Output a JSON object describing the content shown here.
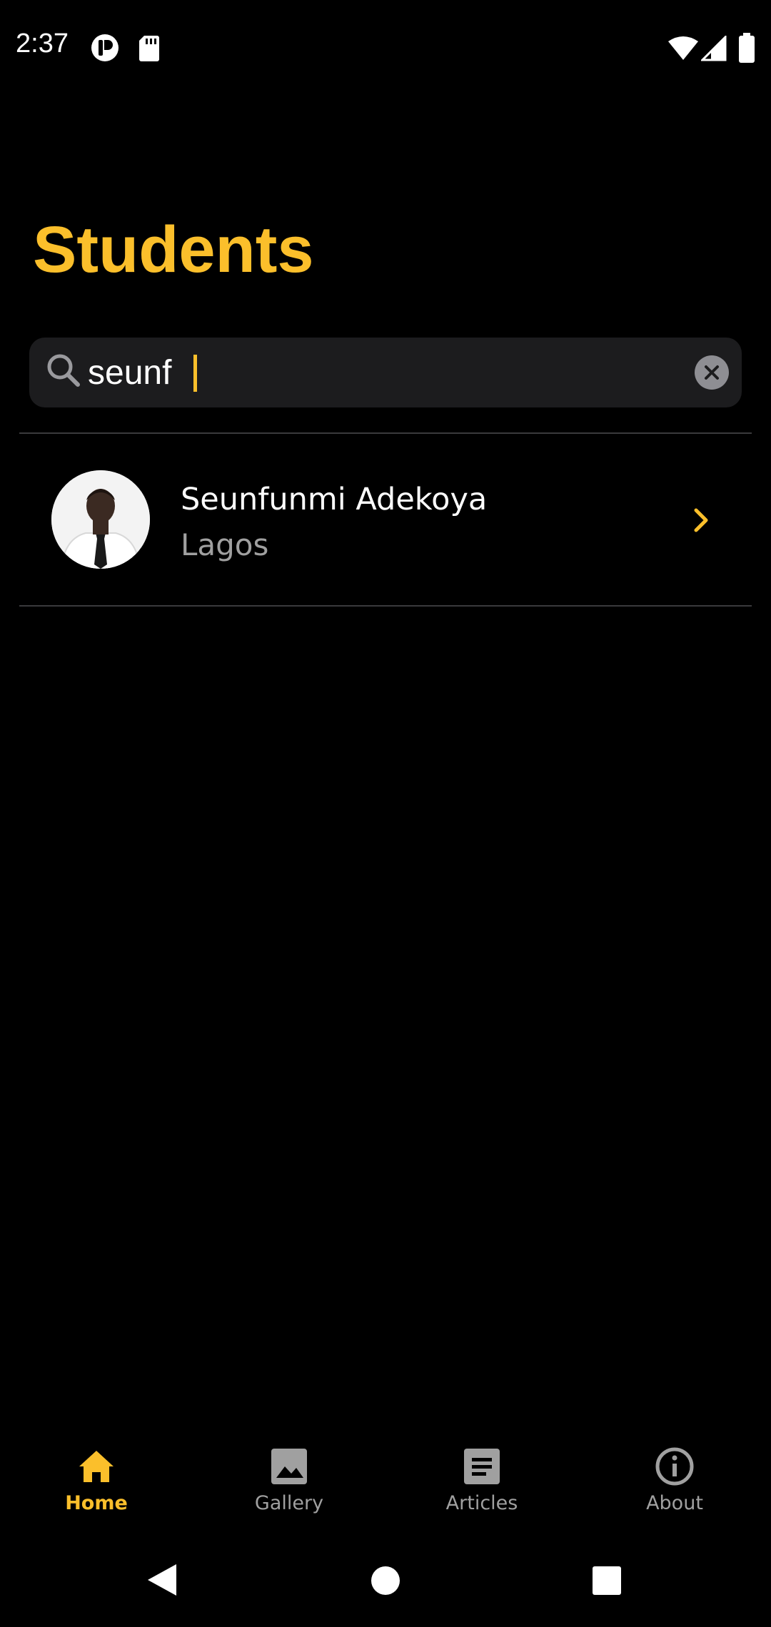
{
  "status_bar": {
    "time": "2:37",
    "icons": [
      "media-app-icon",
      "sd-card-icon",
      "wifi-icon",
      "signal-icon",
      "battery-icon"
    ]
  },
  "title": "Students",
  "search": {
    "value": "seunf",
    "placeholder": "",
    "icon": "search-icon",
    "clear_icon": "clear-icon"
  },
  "results": [
    {
      "name": "Seunfunmi Adekoya",
      "location": "Lagos",
      "avatar": "avatar",
      "chevron_icon": "chevron-right-icon"
    }
  ],
  "bottom_nav": {
    "items": [
      {
        "label": "Home",
        "icon": "home-icon",
        "active": true
      },
      {
        "label": "Gallery",
        "icon": "image-icon",
        "active": false
      },
      {
        "label": "Articles",
        "icon": "article-icon",
        "active": false
      },
      {
        "label": "About",
        "icon": "info-icon",
        "active": false
      }
    ]
  },
  "system_nav": [
    "back-icon",
    "home-circle-icon",
    "recents-icon"
  ],
  "colors": {
    "accent": "#FBBF2B",
    "background": "#000000",
    "search_bg": "#1C1C1E",
    "muted_text": "#A0A0A0"
  }
}
